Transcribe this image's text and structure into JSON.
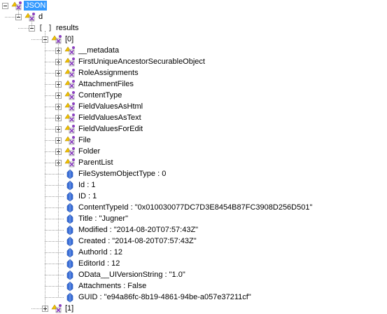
{
  "tree": {
    "nodes": [
      {
        "label": "JSON",
        "level": 0,
        "kind": "object",
        "expander": "minus",
        "selected": true
      },
      {
        "label": "d",
        "level": 1,
        "kind": "object",
        "expander": "minus"
      },
      {
        "label": "results",
        "level": 2,
        "kind": "array",
        "expander": "minus"
      },
      {
        "label": "[0]",
        "level": 3,
        "kind": "object",
        "expander": "minus"
      },
      {
        "label": "__metadata",
        "level": 4,
        "kind": "object",
        "expander": "plus"
      },
      {
        "label": "FirstUniqueAncestorSecurableObject",
        "level": 4,
        "kind": "object",
        "expander": "plus"
      },
      {
        "label": "RoleAssignments",
        "level": 4,
        "kind": "object",
        "expander": "plus"
      },
      {
        "label": "AttachmentFiles",
        "level": 4,
        "kind": "object",
        "expander": "plus"
      },
      {
        "label": "ContentType",
        "level": 4,
        "kind": "object",
        "expander": "plus"
      },
      {
        "label": "FieldValuesAsHtml",
        "level": 4,
        "kind": "object",
        "expander": "plus"
      },
      {
        "label": "FieldValuesAsText",
        "level": 4,
        "kind": "object",
        "expander": "plus"
      },
      {
        "label": "FieldValuesForEdit",
        "level": 4,
        "kind": "object",
        "expander": "plus"
      },
      {
        "label": "File",
        "level": 4,
        "kind": "object",
        "expander": "plus"
      },
      {
        "label": "Folder",
        "level": 4,
        "kind": "object",
        "expander": "plus"
      },
      {
        "label": "ParentList",
        "level": 4,
        "kind": "object",
        "expander": "plus"
      },
      {
        "label": "FileSystemObjectType : 0",
        "level": 4,
        "kind": "value"
      },
      {
        "label": "Id : 1",
        "level": 4,
        "kind": "value"
      },
      {
        "label": "ID : 1",
        "level": 4,
        "kind": "value"
      },
      {
        "label": "ContentTypeId : \"0x010030077DC7D3E8454B87FC3908D256D501\"",
        "level": 4,
        "kind": "value"
      },
      {
        "label": "Title : \"Jugner\"",
        "level": 4,
        "kind": "value"
      },
      {
        "label": "Modified : \"2014-08-20T07:57:43Z\"",
        "level": 4,
        "kind": "value"
      },
      {
        "label": "Created : \"2014-08-20T07:57:43Z\"",
        "level": 4,
        "kind": "value"
      },
      {
        "label": "AuthorId : 12",
        "level": 4,
        "kind": "value"
      },
      {
        "label": "EditorId : 12",
        "level": 4,
        "kind": "value"
      },
      {
        "label": "OData__UIVersionString : \"1.0\"",
        "level": 4,
        "kind": "value"
      },
      {
        "label": "Attachments : False",
        "level": 4,
        "kind": "value"
      },
      {
        "label": "GUID : \"e94a86fc-8b19-4861-94be-a057e37211cf\"",
        "level": 4,
        "kind": "value"
      },
      {
        "label": "[1]",
        "level": 3,
        "kind": "object",
        "expander": "plus"
      }
    ],
    "array_icon_text": "[ ]",
    "icons": {
      "object": "json-object-icon",
      "array": "json-array-icon",
      "value": "json-value-icon"
    },
    "colors": {
      "selection": "#3399ff",
      "object_icon_yellow": "#f2c200",
      "object_icon_purple": "#8a3fbf",
      "value_icon_blue": "#3a6fd8",
      "tree_line": "#a0a0a0"
    }
  }
}
